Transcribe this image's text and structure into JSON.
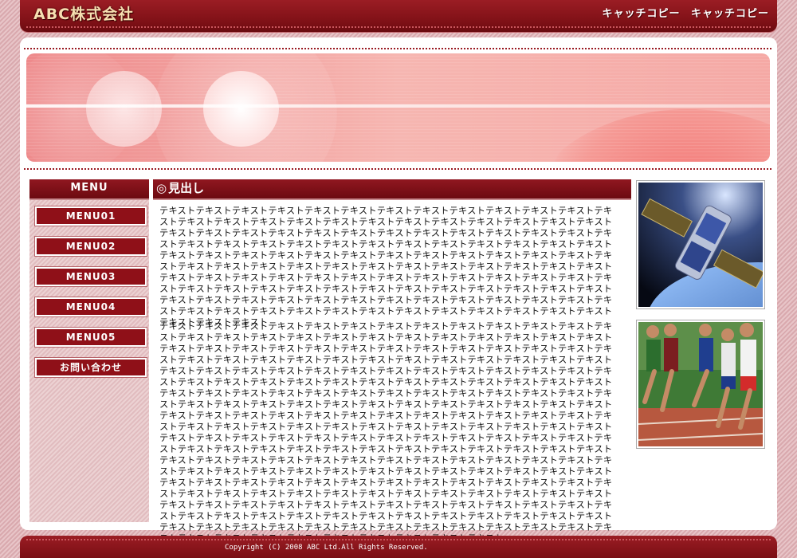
{
  "header": {
    "logo": "ABC株式会社",
    "catch_copies": [
      "キャッチコピー",
      "キャッチコピー"
    ]
  },
  "sidebar": {
    "title": "MENU",
    "items": [
      {
        "label": "MENU01"
      },
      {
        "label": "MENU02"
      },
      {
        "label": "MENU03"
      },
      {
        "label": "MENU04"
      },
      {
        "label": "MENU05"
      },
      {
        "label": "お問い合わせ"
      }
    ]
  },
  "content": {
    "heading_mark": "◎",
    "heading": "見出し",
    "paragraph1": "テキストテキストテキストテキストテキストテキストテキストテキストテキストテキストテキストテキストテキストテキストテキストテキストテキストテキストテキストテキストテキストテキストテキストテキストテキストテキストテキストテキストテキストテキストテキストテキストテキストテキストテキストテキストテキストテキストテキストテキストテキストテキストテキストテキストテキストテキストテキストテキストテキストテキストテキストテキストテキストテキストテキストテキストテキストテキストテキストテキストテキストテキストテキストテキストテキストテキストテキストテキストテキストテキストテキストテキストテキストテキストテキストテキストテキストテキストテキストテキストテキストテキストテキストテキストテキストテキストテキストテキストテキストテキストテキストテキストテキストテキストテキストテキストテキストテキストテキストテキストテキストテキストテキストテキストテキストテキストテキストテキストテキストテキストテキストテキストテキストテキストテキストテキストテキストテキストテキストテキストテキストテキストテキストテキストテキストテキストテキストテキスト",
    "paragraph2": "テキストテキストテキストテキストテキストテキストテキストテキストテキストテキストテキストテキストテキストテキストテキストテキストテキストテキストテキストテキストテキストテキストテキストテキストテキストテキストテキストテキストテキストテキストテキストテキストテキストテキストテキストテキストテキストテキストテキストテキストテキストテキストテキストテキストテキストテキストテキストテキストテキストテキストテキストテキストテキストテキストテキストテキストテキストテキストテキストテキストテキストテキストテキストテキストテキストテキストテキストテキストテキストテキストテキストテキストテキストテキストテキストテキストテキストテキストテキストテキストテキストテキストテキストテキストテキストテキストテキストテキストテキストテキストテキストテキストテキストテキストテキストテキストテキストテキストテキストテキストテキストテキストテキストテキストテキストテキストテキストテキストテキストテキストテキストテキストテキストテキストテキストテキストテキストテキストテキストテキストテキストテキストテキストテキストテキストテキストテキストテキストテキストテキストテキストテキストテキストテキストテキストテキストテキストテキストテキストテキストテキストテキストテキストテキストテキストテキストテキストテキストテキストテキストテキストテキストテキストテキストテキストテキストテキストテキストテキストテキストテキストテキストテキストテキストテキストテキストテキストテキストテキストテキストテキストテキストテキストテキストテキストテキストテキストテキストテキストテキストテキストテキストテキストテキストテキストテキストテキストテキストテキストテキストテキストテキストテキストテキストテキストテキストテキストテキストテキストテキストテキストテキストテキストテキストテキストテキストテキストテキストテキストテキストテキストテキストテキストテキストテキストテキストテキストテキストテキストテキストテキストテキストテキストテキストテキストテキストテキストテキストテキストテキストテキストテキストテキストテキストテキストテキストテキストテキストテキストテキストテキストテキストテキストテキストテキストテキストテキスト"
  },
  "images": {
    "photo1_subject": "satellite-photo",
    "photo2_subject": "runners-photo"
  },
  "footer": {
    "copyright": "Copyright (C) 2008 ABC Ltd.All Rights Reserved."
  },
  "colors": {
    "brand": "#8f1018",
    "banner": "#f4a6a4"
  }
}
